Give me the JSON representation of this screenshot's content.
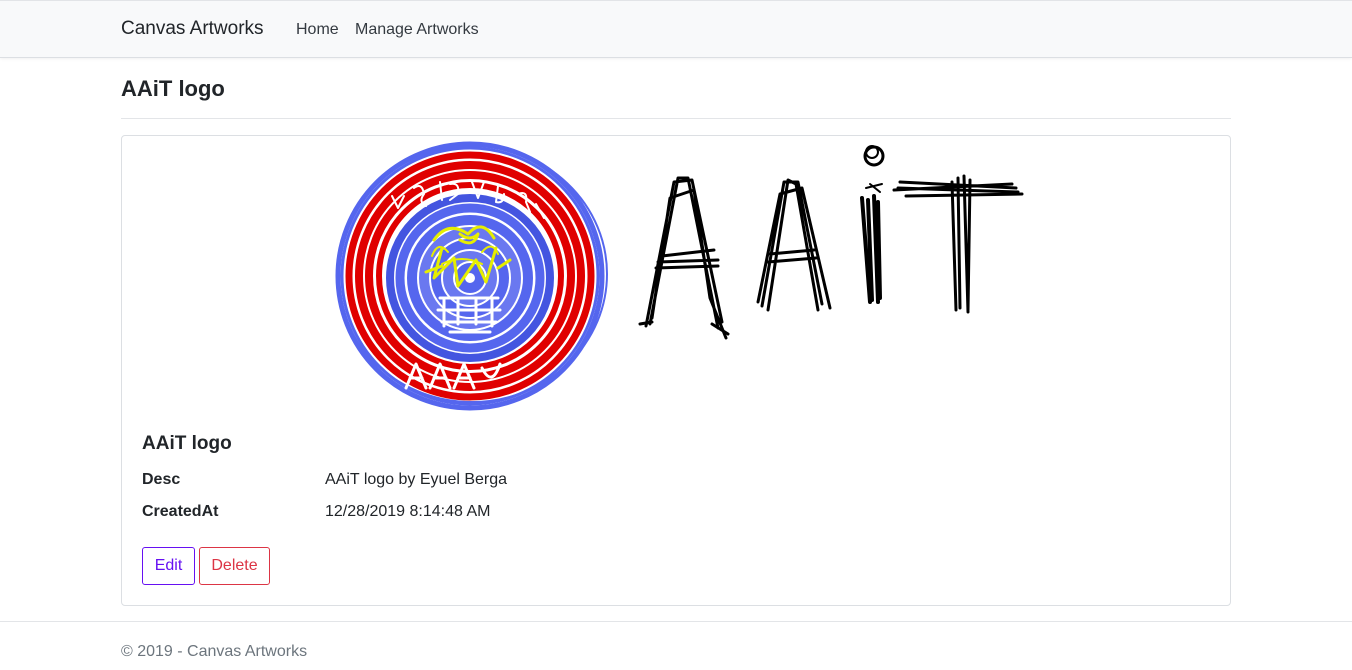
{
  "navbar": {
    "brand": "Canvas Artworks",
    "links": [
      "Home",
      "Manage Artworks"
    ]
  },
  "page": {
    "title": "AAiT logo"
  },
  "card": {
    "artwork_alt": "AAiT logo",
    "title": "AAiT logo",
    "fields": [
      {
        "label": "Desc",
        "value": "AAiT logo by Eyuel Berga"
      },
      {
        "label": "CreatedAt",
        "value": "12/28/2019 8:14:48 AM"
      }
    ],
    "buttons": {
      "edit": "Edit",
      "delete": "Delete"
    }
  },
  "footer": {
    "text": "© 2019 - Canvas Artworks"
  },
  "colors": {
    "edit": "#6610f2",
    "delete": "#dc3545",
    "ring_outer": "#5566ee",
    "ring_red": "#e00000",
    "center_yellow": "#e6ee00",
    "scribble_black": "#000000"
  }
}
